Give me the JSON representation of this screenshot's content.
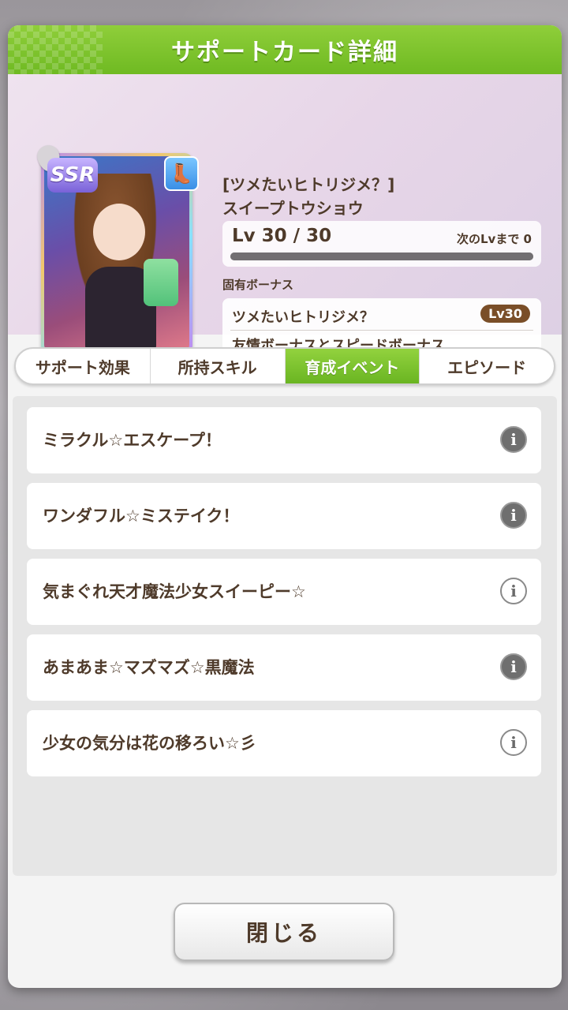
{
  "header": {
    "title": "サポートカード詳細"
  },
  "card": {
    "rarity": "SSR",
    "title_line1": "[ツメたいヒトリジメ？]",
    "title_line2": "スイープトウショウ",
    "level_text": "Lv 30 / 30",
    "next_level_label": "次のLvまで 0",
    "level_progress": 1.0,
    "type_icon": "speed-boot-icon"
  },
  "bonus": {
    "section_label": "固有ボーナス",
    "name": "ツメたいヒトリジメ？",
    "level_badge": "Lv30",
    "description": "友情ボーナスとスピードボーナス"
  },
  "tabs": [
    {
      "label": "サポート効果",
      "active": false
    },
    {
      "label": "所持スキル",
      "active": false
    },
    {
      "label": "育成イベント",
      "active": true
    },
    {
      "label": "エピソード",
      "active": false
    }
  ],
  "events": [
    {
      "label": "ミラクル☆エスケープ！",
      "info_style": "filled"
    },
    {
      "label": "ワンダフル☆ミステイク！",
      "info_style": "filled"
    },
    {
      "label": "気まぐれ天才魔法少女スイーピー☆",
      "info_style": "outline"
    },
    {
      "label": "あまあま☆マズマズ☆黒魔法",
      "info_style": "filled"
    },
    {
      "label": "少女の気分は花の移ろい☆彡",
      "info_style": "outline"
    }
  ],
  "info_glyph": "i",
  "footer": {
    "close_label": "閉じる"
  },
  "colors": {
    "accent_green": "#7cc42c",
    "text_brown": "#4e3a2a"
  }
}
